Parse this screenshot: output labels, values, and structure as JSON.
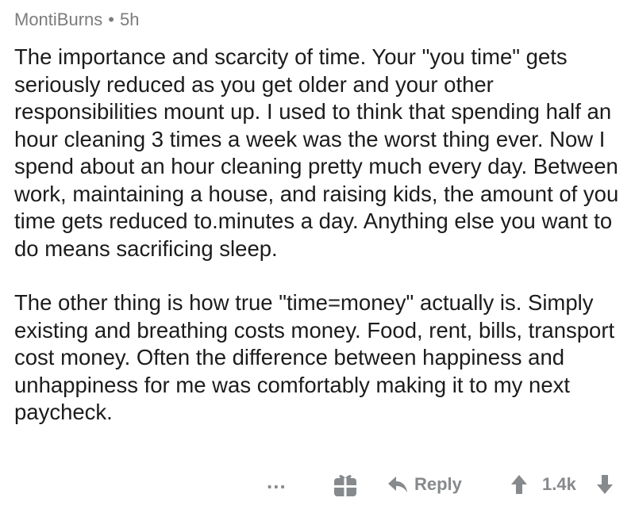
{
  "comment": {
    "author": "MontiBurns",
    "separator": "•",
    "age": "5h",
    "paragraphs": [
      "The importance and scarcity of time. Your \"you time\" gets seriously reduced as you get older and your other responsibilities mount up.  I used to think that spending half an hour cleaning 3 times a week was the worst thing ever.  Now I spend about an hour cleaning pretty much every day.  Between work, maintaining a house, and raising kids, the amount of you time gets reduced to.minutes a day.  Anything else you want to do means sacrificing sleep.",
      "The other thing is how true \"time=money\" actually is.  Simply existing and breathing costs money.  Food, rent, bills, transport cost money.  Often the difference between happiness and unhappiness for me was comfortably making it to my next paycheck."
    ]
  },
  "actions": {
    "more_label": "...",
    "reply_label": "Reply",
    "score": "1.4k",
    "icons": {
      "more": "more-options-icon",
      "gift": "gift-award-icon",
      "reply": "reply-arrow-icon",
      "upvote": "upvote-arrow-icon",
      "downvote": "downvote-arrow-icon"
    },
    "icon_color": "#878a8c"
  }
}
